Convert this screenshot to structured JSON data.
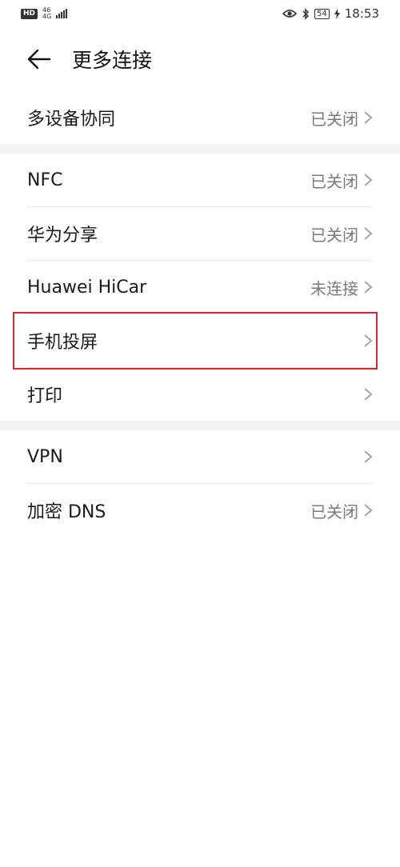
{
  "status_bar": {
    "hd": "HD",
    "net_top": "46",
    "net_bottom": "4G",
    "battery": "54",
    "time": "18:53"
  },
  "header": {
    "title": "更多连接"
  },
  "groups": [
    {
      "items": [
        {
          "label": "多设备协同",
          "value": "已关闭"
        }
      ]
    },
    {
      "items": [
        {
          "label": "NFC",
          "value": "已关闭"
        },
        {
          "label": "华为分享",
          "value": "已关闭"
        },
        {
          "label": "Huawei HiCar",
          "value": "未连接"
        },
        {
          "label": "手机投屏",
          "value": ""
        },
        {
          "label": "打印",
          "value": ""
        }
      ]
    },
    {
      "items": [
        {
          "label": "VPN",
          "value": ""
        },
        {
          "label": "加密 DNS",
          "value": "已关闭"
        }
      ]
    }
  ],
  "highlight_color": "#d8262e"
}
